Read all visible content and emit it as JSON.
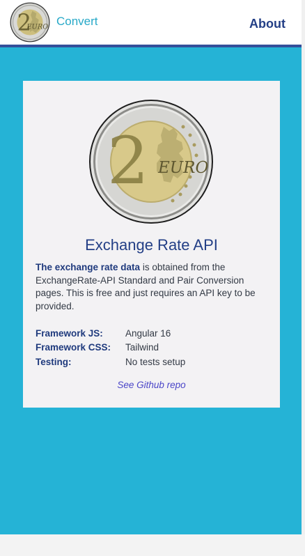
{
  "nav": {
    "logo_text": "EURO",
    "logo_numeral": "2",
    "convert_label": "Convert",
    "about_label": "About"
  },
  "card": {
    "coin_numeral": "2",
    "coin_text": "EURO",
    "title": "Exchange Rate API",
    "description_bold": "The exchange rate data",
    "description_rest": " is obtained from the ExchangeRate-API Standard and Pair Conversion pages. This is free and just requires an API key to be provided.",
    "info": [
      {
        "label": "Framework JS:",
        "value": "Angular 16"
      },
      {
        "label": "Framework CSS:",
        "value": "Tailwind"
      },
      {
        "label": "Testing:",
        "value": "No tests setup"
      }
    ],
    "github_link": "See Github repo"
  },
  "colors": {
    "page_background": "#25b3d6",
    "card_background": "#f3f2f4",
    "accent_dark_blue": "#233f86",
    "nav_link_teal": "#28a9c8",
    "link_purple": "#4a45c8"
  },
  "icons": {
    "logo": "two-euro-coin-icon",
    "card_image": "two-euro-coin-icon"
  }
}
